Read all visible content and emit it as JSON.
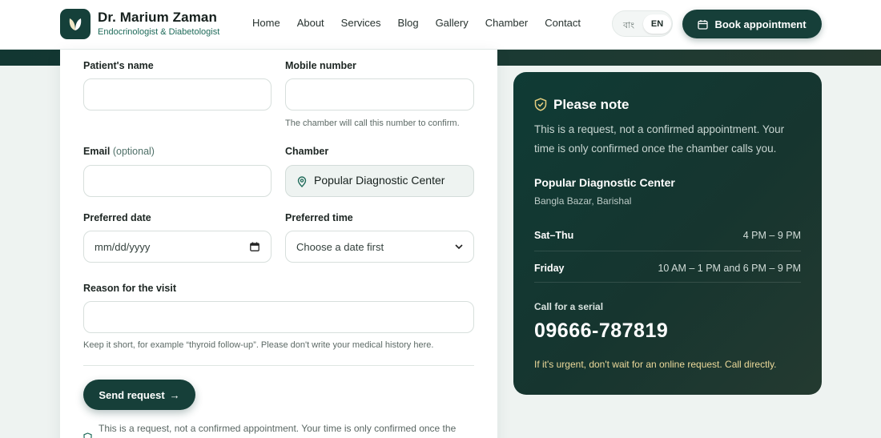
{
  "header": {
    "doctor_name": "Dr. Marium Zaman",
    "doctor_title": "Endocrinologist & Diabetologist",
    "nav": [
      "Home",
      "About",
      "Services",
      "Blog",
      "Gallery",
      "Chamber",
      "Contact"
    ],
    "lang_bn": "বাং",
    "lang_en": "EN",
    "book_label": "Book appointment",
    "logo_icon": "leaf-logo-icon",
    "calendar_icon": "calendar-icon"
  },
  "form": {
    "patient_name_label": "Patient's name",
    "patient_name_value": "",
    "mobile_label": "Mobile number",
    "mobile_value": "",
    "mobile_hint": "The chamber will call this number to confirm.",
    "email_label": "Email",
    "email_optional": "(optional)",
    "email_value": "",
    "chamber_label": "Chamber",
    "chamber_value": "Popular Diagnostic Center",
    "date_label": "Preferred date",
    "date_placeholder": "mm/dd/yyyy",
    "time_label": "Preferred time",
    "time_value": "Choose a date first",
    "reason_label": "Reason for the visit",
    "reason_value": "",
    "reason_hint": "Keep it short, for example “thyroid follow-up”. Please don't write your medical history here.",
    "send_label": "Send request",
    "send_arrow": "→",
    "footer_note": "This is a request, not a confirmed appointment. Your time is only confirmed once the"
  },
  "note": {
    "title": "Please note",
    "description": "This is a request, not a confirmed appointment. Your time is only confirmed once the chamber calls you.",
    "chamber_name": "Popular Diagnostic Center",
    "chamber_location": "Bangla Bazar, Barishal",
    "schedule": [
      {
        "day": "Sat–Thu",
        "time": "4 PM – 9 PM"
      },
      {
        "day": "Friday",
        "time": "10 AM – 1 PM and 6 PM – 9 PM"
      }
    ],
    "serial_label": "Call for a serial",
    "serial_number": "09666-787819",
    "urgent_text": "If it's urgent, don't wait for an online request. Call directly."
  },
  "colors": {
    "brand_dark": "#163f39",
    "accent_green": "#1f6b5a",
    "urgent_gold": "#ecd99a"
  }
}
